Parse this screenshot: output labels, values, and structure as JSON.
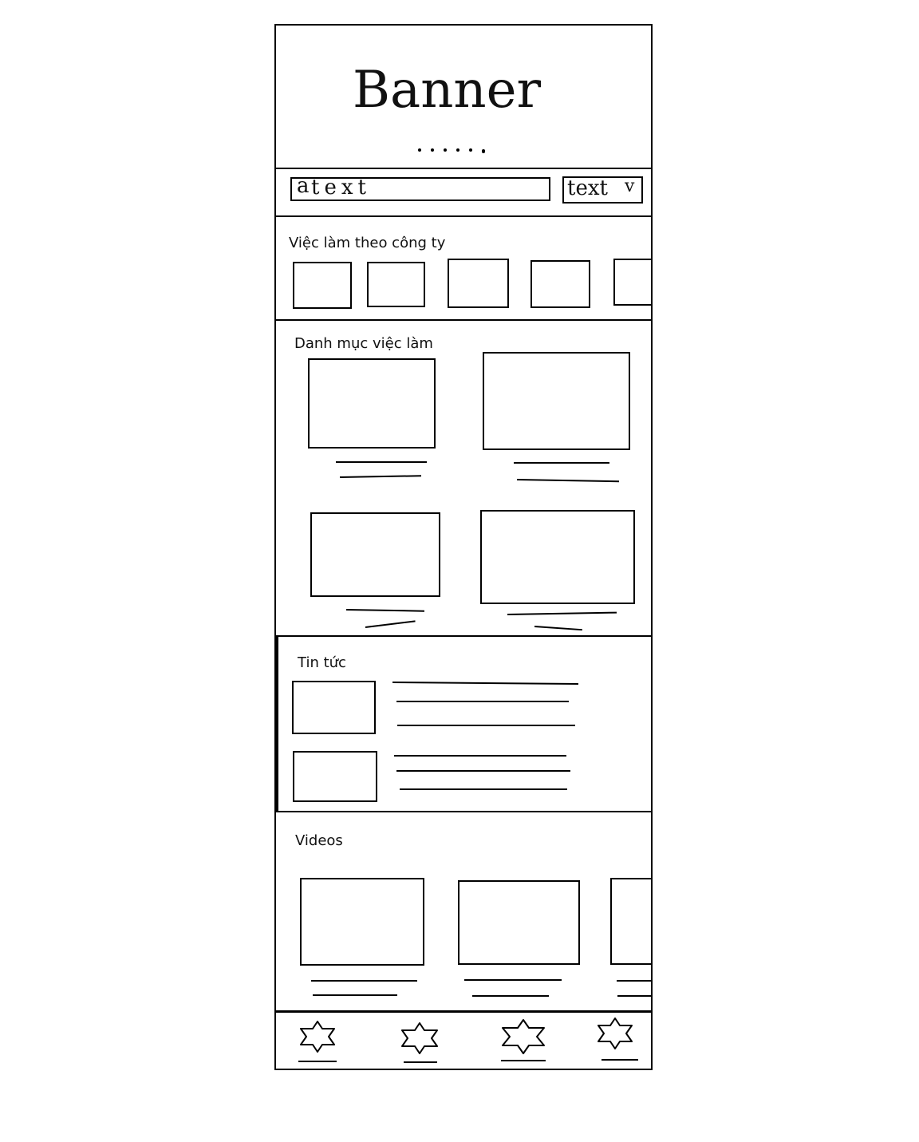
{
  "banner": {
    "label": "Banner",
    "carousel_pages": 6
  },
  "search": {
    "input_text": "text",
    "dropdown_text": "text"
  },
  "companies": {
    "title": "Việc làm theo công ty"
  },
  "categories": {
    "title": "Danh mục việc làm"
  },
  "news": {
    "title": "Tin tức"
  },
  "videos": {
    "title": "Videos"
  },
  "bottom_nav": {
    "items": [
      "star-icon",
      "star-icon",
      "star-icon",
      "star-icon"
    ]
  }
}
